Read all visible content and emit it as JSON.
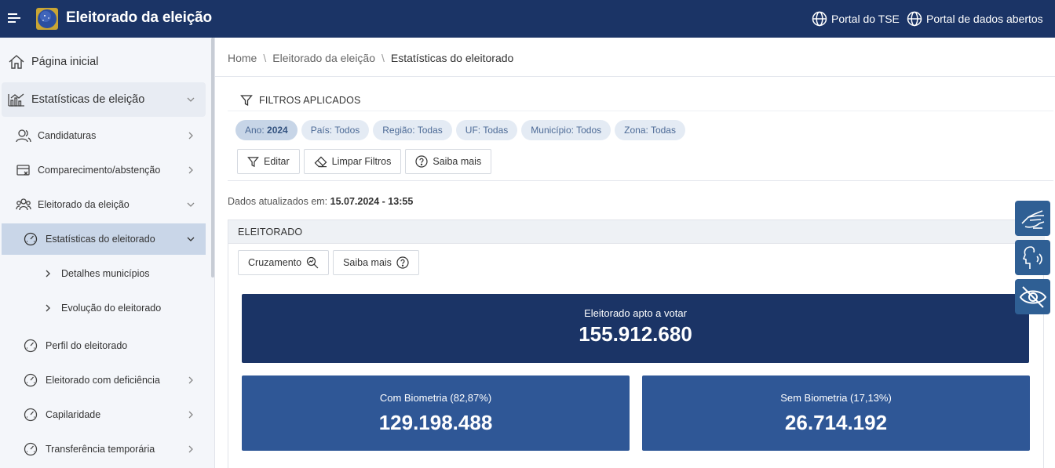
{
  "header": {
    "title": "Eleitorado da eleição",
    "links": [
      "Portal do TSE",
      "Portal de dados abertos"
    ]
  },
  "sidebar": {
    "items": [
      {
        "label": "Página inicial"
      },
      {
        "label": "Estatísticas de eleição"
      },
      {
        "label": "Candidaturas"
      },
      {
        "label": "Comparecimento/abstenção"
      },
      {
        "label": "Eleitorado da eleição"
      },
      {
        "label": "Estatísticas do eleitorado"
      },
      {
        "label": "Detalhes municípios"
      },
      {
        "label": "Evolução do eleitorado"
      },
      {
        "label": "Perfil do eleitorado"
      },
      {
        "label": "Eleitorado com deficiência"
      },
      {
        "label": "Capilaridade"
      },
      {
        "label": "Transferência temporária"
      }
    ]
  },
  "breadcrumb": [
    "Home",
    "Eleitorado da eleição",
    "Estatísticas do eleitorado"
  ],
  "filters": {
    "title": "FILTROS APLICADOS",
    "chips": [
      {
        "key": "Ano:",
        "value": "2024"
      },
      {
        "key": "País:",
        "value": "Todos"
      },
      {
        "key": "Região:",
        "value": "Todas"
      },
      {
        "key": "UF:",
        "value": "Todas"
      },
      {
        "key": "Município:",
        "value": "Todos"
      },
      {
        "key": "Zona:",
        "value": "Todas"
      }
    ],
    "actions": [
      "Editar",
      "Limpar Filtros",
      "Saiba mais"
    ]
  },
  "updated": {
    "label": "Dados atualizados em:",
    "value": "15.07.2024 - 13:55"
  },
  "panel": {
    "title": "ELEITORADO",
    "buttons": [
      "Cruzamento",
      "Saiba mais"
    ],
    "total": {
      "label": "Eleitorado apto a votar",
      "value": "155.912.680"
    },
    "with_bio": {
      "label": "Com Biometria (82,87%)",
      "value": "129.198.488"
    },
    "without_bio": {
      "label": "Sem Biometria (17,13%)",
      "value": "26.714.192"
    }
  },
  "colors": {
    "header": "#1b3466",
    "stat_dark": "#1b3466",
    "stat_mid": "#2f5796",
    "a11y": "#2f5f94"
  }
}
